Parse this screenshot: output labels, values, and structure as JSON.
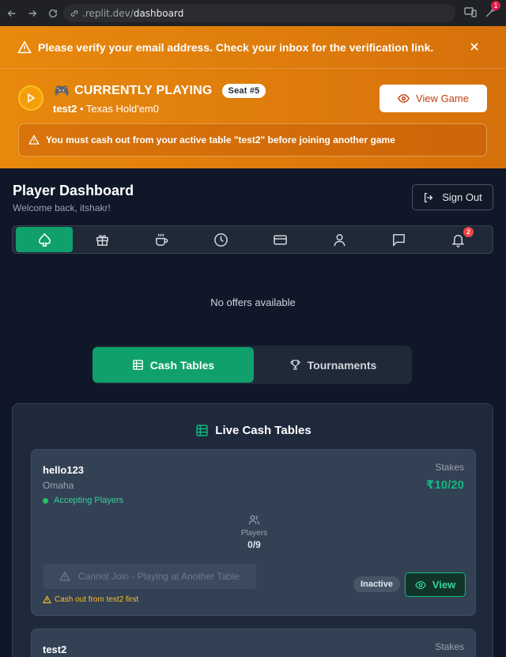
{
  "browser": {
    "url_prefix": ".replit.dev/",
    "url_path": "dashboard",
    "notification_count": "1"
  },
  "banner": {
    "verify_message": "Please verify your email address. Check your inbox for the verification link.",
    "playing_icon": "🎮",
    "playing_title": "CURRENTLY PLAYING",
    "seat_badge": "Seat #5",
    "table_name": "test2",
    "separator": " • ",
    "game_type": "Texas Hold'em0",
    "view_game_label": "View Game",
    "cashout_warning": "You must cash out from your active table \"test2\" before joining another game"
  },
  "header": {
    "title": "Player Dashboard",
    "welcome": "Welcome back, itshakr!",
    "signout_label": "Sign Out"
  },
  "tabs": {
    "items": [
      {
        "icon": "spade-icon",
        "active": true
      },
      {
        "icon": "gift-icon"
      },
      {
        "icon": "coffee-icon"
      },
      {
        "icon": "clock-icon"
      },
      {
        "icon": "credit-card-icon"
      },
      {
        "icon": "user-icon"
      },
      {
        "icon": "message-icon"
      },
      {
        "icon": "bell-icon",
        "badge": "2"
      }
    ]
  },
  "offers": {
    "empty_text": "No offers available"
  },
  "segment": {
    "cash_label": "Cash Tables",
    "tournaments_label": "Tournaments"
  },
  "panel": {
    "title": "Live Cash Tables",
    "tables": [
      {
        "name": "hello123",
        "game": "Omaha",
        "status": "Accepting Players",
        "stakes_label": "Stakes",
        "stakes": "₹10/20",
        "players_label": "Players",
        "players": "0/9",
        "join_label": "Cannot Join - Playing at Another Table",
        "cashout_note": "Cash out from test2 first",
        "state_badge": "Inactive",
        "view_label": "View"
      },
      {
        "name": "test2",
        "stakes_label": "Stakes"
      }
    ]
  },
  "colors": {
    "accent_green": "#10a06c",
    "banner_orange": "#e8890d",
    "background": "#0f1729"
  }
}
